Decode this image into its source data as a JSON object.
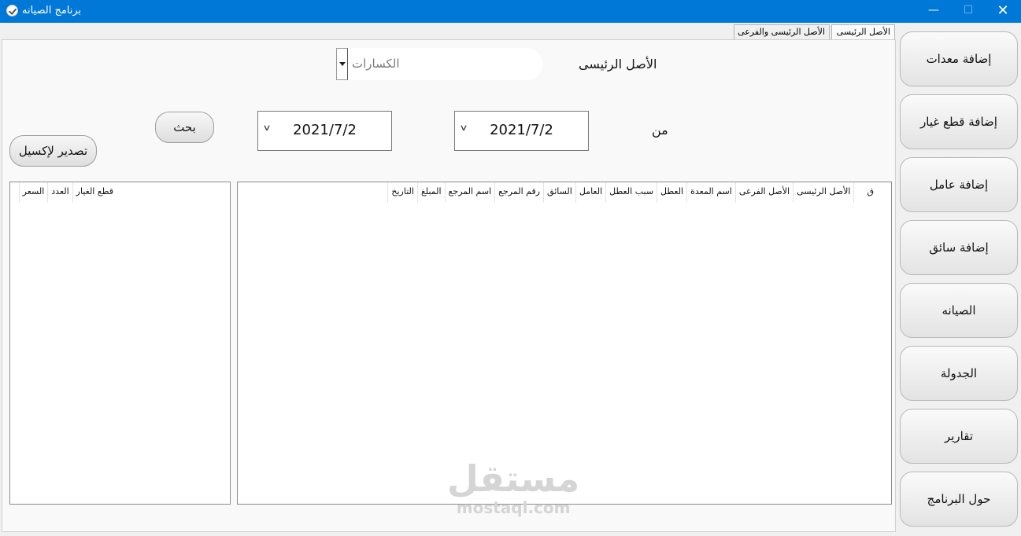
{
  "window": {
    "title": "برنامج الصيانه",
    "controls": {
      "minimize": "—",
      "maximize": "☐",
      "close": "✕"
    }
  },
  "tabs": [
    {
      "label": "الأصل الرئيسى",
      "active": true
    },
    {
      "label": "الأصل الرئيسى والفرعى",
      "active": false
    }
  ],
  "sidebar": {
    "items": [
      {
        "label": "إضافة معدات"
      },
      {
        "label": "إضافة قطع غيار"
      },
      {
        "label": "إضافة عامل"
      },
      {
        "label": "إضافة سائق"
      },
      {
        "label": "الصيانه"
      },
      {
        "label": "الجدولة"
      },
      {
        "label": "تقارير"
      },
      {
        "label": "حول البرنامج"
      }
    ]
  },
  "form": {
    "main_asset_label": "الأصل الرئيسى",
    "main_asset_value": "الكسارات",
    "from_label": "من",
    "from_date": "2021/7/2",
    "to_date": "2021/7/2",
    "search_button": "بحث",
    "export_button": "تصدير لإكسيل"
  },
  "main_grid": {
    "columns": [
      "ق",
      "الأصل الرئيسى",
      "الأصل الفرعى",
      "اسم المعدة",
      "العطل",
      "سبب العطل",
      "العامل",
      "السائق",
      "رقم المرجع",
      "اسم المرجع",
      "المبلغ",
      "التاريخ"
    ]
  },
  "parts_grid": {
    "columns": [
      "قطع الغيار",
      "العدد",
      "السعر"
    ]
  },
  "watermark": {
    "arabic": "مستقل",
    "latin": "mostaql.com"
  }
}
